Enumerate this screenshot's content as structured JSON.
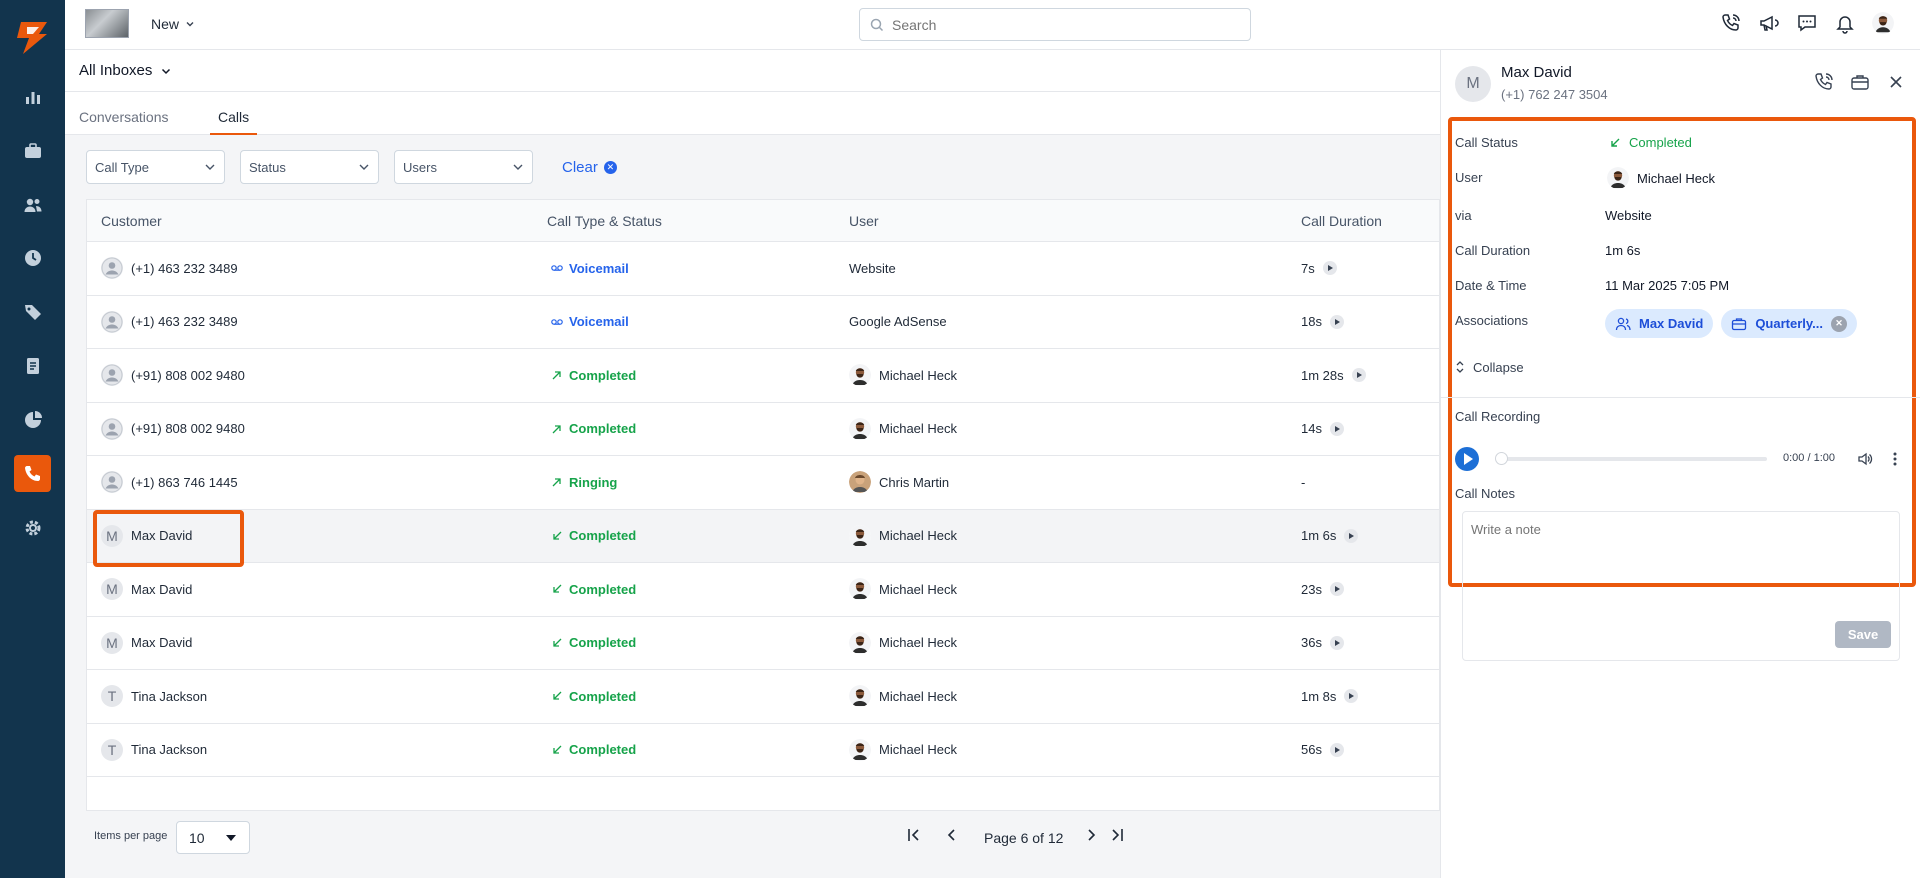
{
  "colors": {
    "sidebar": "#12344d",
    "accent": "#ea580c",
    "link": "#2563eb",
    "success": "#16a34a"
  },
  "topbar": {
    "new_label": "New",
    "search_placeholder": "Search"
  },
  "inbox": {
    "label": "All Inboxes"
  },
  "tabs": [
    {
      "label": "Conversations"
    },
    {
      "label": "Calls"
    }
  ],
  "filters": {
    "call_type": "Call Type",
    "status": "Status",
    "users": "Users",
    "clear": "Clear"
  },
  "table": {
    "headers": [
      "Customer",
      "Call Type & Status",
      "User",
      "Call Duration"
    ],
    "rows": [
      {
        "customer": "(+1) 463 232 3489",
        "avatar": "",
        "status": "Voicemail",
        "user": "Website",
        "duration": "7s"
      },
      {
        "customer": "(+1) 463 232 3489",
        "avatar": "",
        "status": "Voicemail",
        "user": "Google AdSense",
        "duration": "18s"
      },
      {
        "customer": "(+91) 808 002 9480",
        "avatar": "",
        "status": "Completed",
        "user": "Michael Heck",
        "duration": "1m 28s"
      },
      {
        "customer": "(+91) 808 002 9480",
        "avatar": "",
        "status": "Completed",
        "user": "Michael Heck",
        "duration": "14s"
      },
      {
        "customer": "(+1) 863 746 1445",
        "avatar": "",
        "status": "Ringing",
        "user": "Chris Martin",
        "duration": "-"
      },
      {
        "customer": "Max David",
        "avatar": "M",
        "status": "Completed",
        "user": "Michael Heck",
        "duration": "1m 6s"
      },
      {
        "customer": "Max David",
        "avatar": "M",
        "status": "Completed",
        "user": "Michael Heck",
        "duration": "23s"
      },
      {
        "customer": "Max David",
        "avatar": "M",
        "status": "Completed",
        "user": "Michael Heck",
        "duration": "36s"
      },
      {
        "customer": "Tina Jackson",
        "avatar": "T",
        "status": "Completed",
        "user": "Michael Heck",
        "duration": "1m 8s"
      },
      {
        "customer": "Tina Jackson",
        "avatar": "T",
        "status": "Completed",
        "user": "Michael Heck",
        "duration": "56s"
      }
    ]
  },
  "pager": {
    "items_label": "Items per page",
    "items_value": "10",
    "page_text": "Page 6 of 12"
  },
  "panel": {
    "avatar": "M",
    "name": "Max David",
    "phone": "(+1) 762 247 3504",
    "call_status_label": "Call Status",
    "call_status": "Completed",
    "user_label": "User",
    "user": "Michael Heck",
    "via_label": "via",
    "via": "Website",
    "duration_label": "Call Duration",
    "duration": "1m 6s",
    "datetime_label": "Date & Time",
    "datetime": "11 Mar 2025 7:05 PM",
    "assoc_label": "Associations",
    "assoc_contact": "Max David",
    "assoc_deal": "Quarterly...",
    "collapse": "Collapse",
    "recording_label": "Call Recording",
    "recording_time": "0:00 / 1:00",
    "notes_label": "Call Notes",
    "notes_placeholder": "Write a note",
    "save": "Save"
  }
}
